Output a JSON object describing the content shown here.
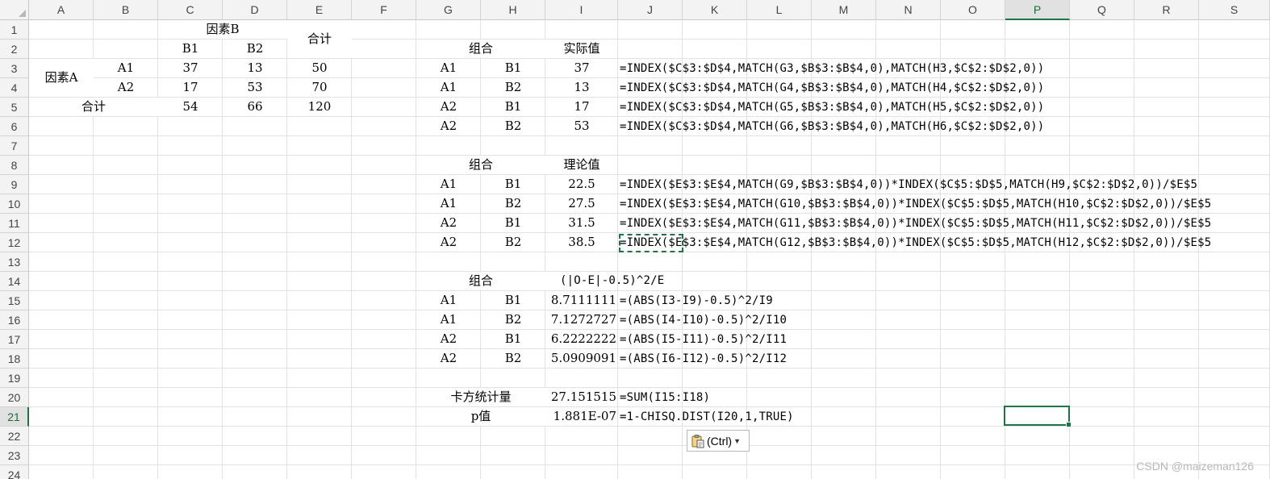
{
  "columns": [
    "A",
    "B",
    "C",
    "D",
    "E",
    "F",
    "G",
    "H",
    "I",
    "J",
    "K",
    "L",
    "M",
    "N",
    "O",
    "P",
    "Q",
    "R",
    "S"
  ],
  "rows": [
    "1",
    "2",
    "3",
    "4",
    "5",
    "6",
    "7",
    "8",
    "9",
    "10",
    "11",
    "12",
    "13",
    "14",
    "15",
    "16",
    "17",
    "18",
    "19",
    "20",
    "21",
    "22",
    "23",
    "24"
  ],
  "selected_column": "P",
  "selected_row": "21",
  "table1": {
    "factor_b": "因素B",
    "total": "合计",
    "b1": "B1",
    "b2": "B2",
    "factor_a": "因素A",
    "a1": "A1",
    "a2": "A2",
    "a1_b1": "37",
    "a1_b2": "13",
    "a1_total": "50",
    "a2_b1": "17",
    "a2_b2": "53",
    "a2_total": "70",
    "total_label": "合计",
    "col_total_b1": "54",
    "col_total_b2": "66",
    "grand_total": "120"
  },
  "actual": {
    "header_group": "组合",
    "header_value": "实际值",
    "rows": [
      {
        "a": "A1",
        "b": "B1",
        "v": "37",
        "f": "=INDEX($C$3:$D$4,MATCH(G3,$B$3:$B$4,0),MATCH(H3,$C$2:$D$2,0))"
      },
      {
        "a": "A1",
        "b": "B2",
        "v": "13",
        "f": "=INDEX($C$3:$D$4,MATCH(G4,$B$3:$B$4,0),MATCH(H4,$C$2:$D$2,0))"
      },
      {
        "a": "A2",
        "b": "B1",
        "v": "17",
        "f": "=INDEX($C$3:$D$4,MATCH(G5,$B$3:$B$4,0),MATCH(H5,$C$2:$D$2,0))"
      },
      {
        "a": "A2",
        "b": "B2",
        "v": "53",
        "f": "=INDEX($C$3:$D$4,MATCH(G6,$B$3:$B$4,0),MATCH(H6,$C$2:$D$2,0))"
      }
    ]
  },
  "theory": {
    "header_group": "组合",
    "header_value": "理论值",
    "rows": [
      {
        "a": "A1",
        "b": "B1",
        "v": "22.5",
        "f": "=INDEX($E$3:$E$4,MATCH(G9,$B$3:$B$4,0))*INDEX($C$5:$D$5,MATCH(H9,$C$2:$D$2,0))/$E$5"
      },
      {
        "a": "A1",
        "b": "B2",
        "v": "27.5",
        "f": "=INDEX($E$3:$E$4,MATCH(G10,$B$3:$B$4,0))*INDEX($C$5:$D$5,MATCH(H10,$C$2:$D$2,0))/$E$5"
      },
      {
        "a": "A2",
        "b": "B1",
        "v": "31.5",
        "f": "=INDEX($E$3:$E$4,MATCH(G11,$B$3:$B$4,0))*INDEX($C$5:$D$5,MATCH(H11,$C$2:$D$2,0))/$E$5"
      },
      {
        "a": "A2",
        "b": "B2",
        "v": "38.5",
        "f": "=INDEX($E$3:$E$4,MATCH(G12,$B$3:$B$4,0))*INDEX($C$5:$D$5,MATCH(H12,$C$2:$D$2,0))/$E$5"
      }
    ]
  },
  "chi": {
    "header_group": "组合",
    "header_value": "(|O-E|-0.5)^2/E",
    "rows": [
      {
        "a": "A1",
        "b": "B1",
        "v": "8.7111111",
        "f": "=(ABS(I3-I9)-0.5)^2/I9"
      },
      {
        "a": "A1",
        "b": "B2",
        "v": "7.1272727",
        "f": "=(ABS(I4-I10)-0.5)^2/I10"
      },
      {
        "a": "A2",
        "b": "B1",
        "v": "6.2222222",
        "f": "=(ABS(I5-I11)-0.5)^2/I11"
      },
      {
        "a": "A2",
        "b": "B2",
        "v": "5.0909091",
        "f": "=(ABS(I6-I12)-0.5)^2/I12"
      }
    ]
  },
  "stats": {
    "chi_label": "卡方统计量",
    "chi_value": "27.151515",
    "chi_formula": "=SUM(I15:I18)",
    "p_label": "p值",
    "p_value": "1.881E-07",
    "p_formula": "=1-CHISQ.DIST(I20,1,TRUE)"
  },
  "paste_options": {
    "label": "(Ctrl)",
    "icon": "clipboard-icon"
  },
  "watermark": "CSDN @maizeman126",
  "colors": {
    "accent": "#217346",
    "grid": "#e2e2e2",
    "header_bg": "#f3f3f3"
  }
}
